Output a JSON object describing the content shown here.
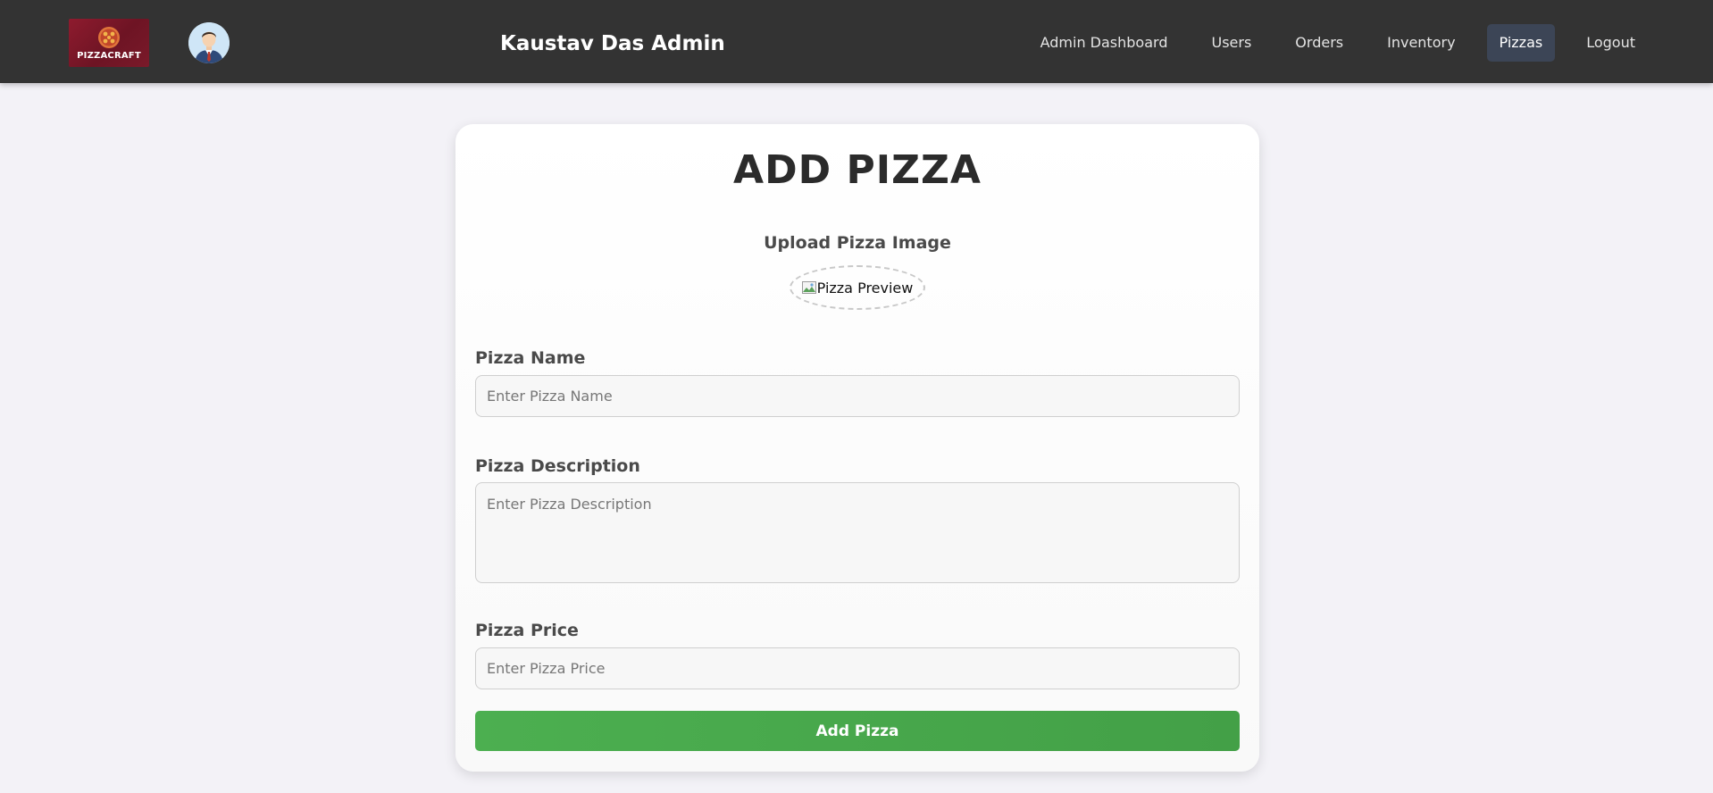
{
  "header": {
    "logo_text": "PIZZACRAFT",
    "title": "Kaustav Das Admin",
    "nav": [
      {
        "label": "Admin Dashboard",
        "active": false
      },
      {
        "label": "Users",
        "active": false
      },
      {
        "label": "Orders",
        "active": false
      },
      {
        "label": "Inventory",
        "active": false
      },
      {
        "label": "Pizzas",
        "active": true
      },
      {
        "label": "Logout",
        "active": false
      }
    ]
  },
  "form": {
    "title": "ADD PIZZA",
    "upload_label": "Upload Pizza Image",
    "preview_alt": "Pizza Preview",
    "name_label": "Pizza Name",
    "name_placeholder": "Enter Pizza Name",
    "name_value": "",
    "description_label": "Pizza Description",
    "description_placeholder": "Enter Pizza Description",
    "description_value": "",
    "price_label": "Pizza Price",
    "price_placeholder": "Enter Pizza Price",
    "price_value": "",
    "submit_label": "Add Pizza"
  },
  "colors": {
    "navbar_bg": "#333333",
    "active_nav_bg": "#3c4556",
    "page_bg": "#f3f2f7",
    "submit_bg": "#4caf50",
    "logo_bg": "#8e1b2e"
  }
}
